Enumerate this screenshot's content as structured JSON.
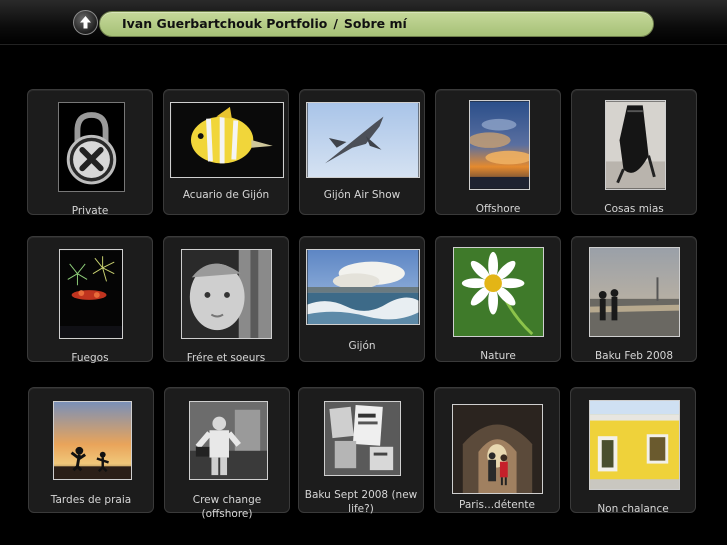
{
  "header": {
    "breadcrumb_root": "Ivan Guerbartchouk Portfolio",
    "separator": "/",
    "breadcrumb_current": "Sobre mí"
  },
  "albums": [
    {
      "title": "Private",
      "icon": "lock-icon"
    },
    {
      "title": "Acuario de Gijón",
      "icon": "fish-photo"
    },
    {
      "title": "Gijón Air Show",
      "icon": "jet-photo"
    },
    {
      "title": "Offshore",
      "icon": "sunset-sky-photo"
    },
    {
      "title": "Cosas mias",
      "icon": "bag-photo"
    },
    {
      "title": "Fuegos",
      "icon": "fireworks-photo"
    },
    {
      "title": "Frére et soeurs",
      "icon": "child-portrait-photo"
    },
    {
      "title": "Gijón",
      "icon": "coast-photo"
    },
    {
      "title": "Nature",
      "icon": "daisy-photo"
    },
    {
      "title": "Baku Feb 2008",
      "icon": "waterfront-photo"
    },
    {
      "title": "Tardes de praia",
      "icon": "beach-silhouette-photo"
    },
    {
      "title": "Crew change (offshore)",
      "icon": "worker-photo"
    },
    {
      "title": "Baku Sept 2008 (new life?)",
      "icon": "posters-photo"
    },
    {
      "title": "Paris...détente",
      "icon": "tunnel-couple-photo"
    },
    {
      "title": "Non chalance",
      "icon": "yellow-house-photo"
    }
  ]
}
